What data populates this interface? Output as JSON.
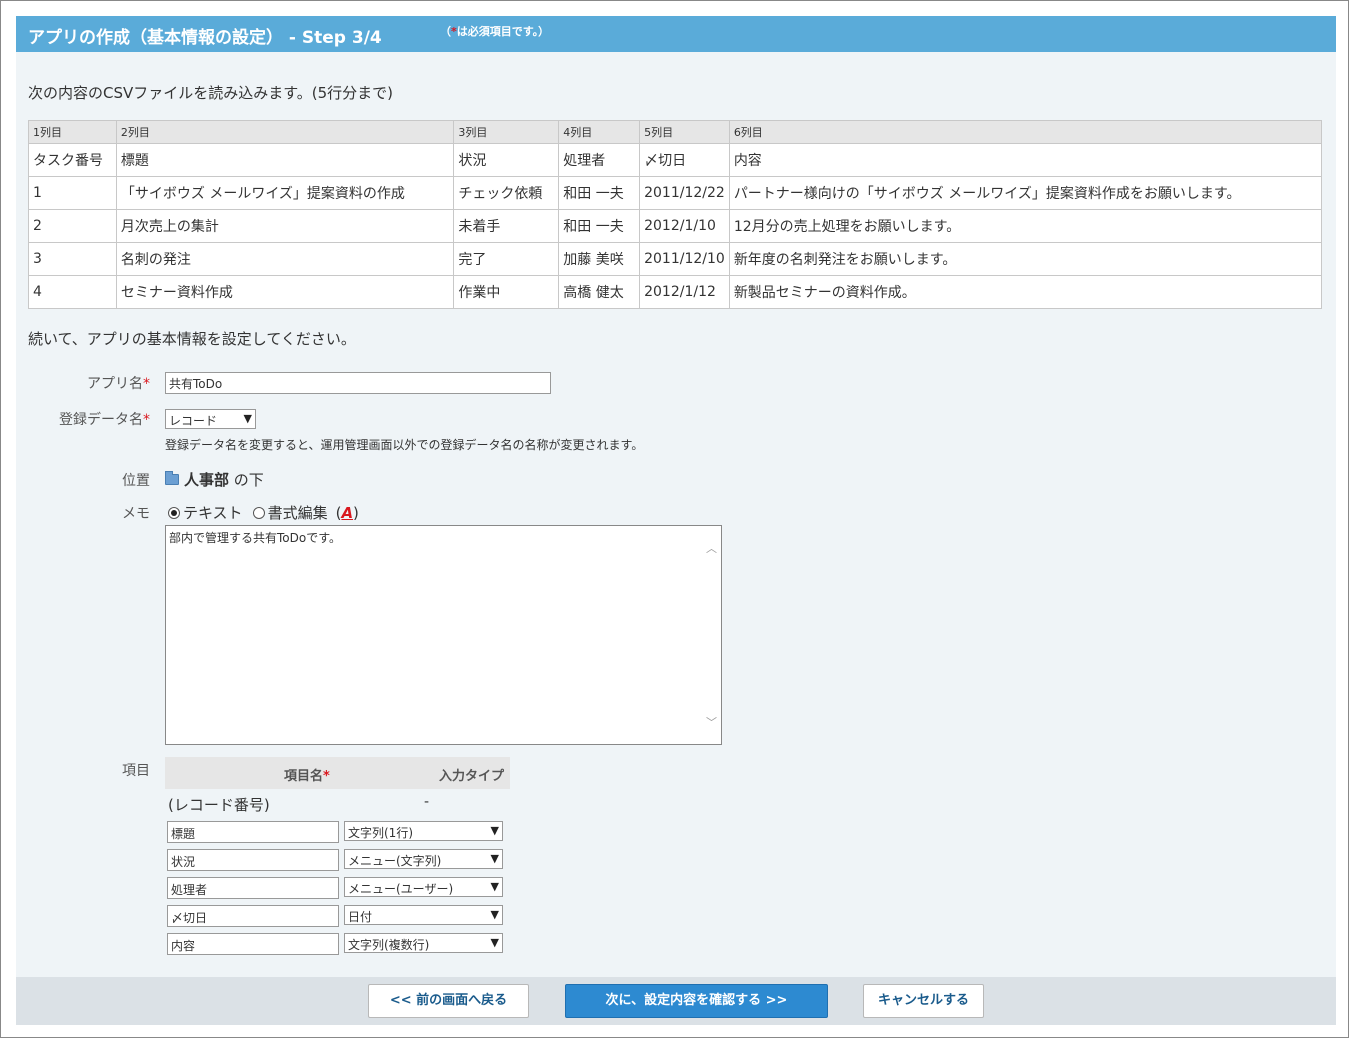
{
  "header": {
    "title": "アプリの作成（基本情報の設定） - Step 3/4",
    "note_open": "（",
    "note_req": "*",
    "note_text": "は必須項目です。）"
  },
  "intro": "次の内容のCSVファイルを読み込みます。(5行分まで)",
  "csv": {
    "columns": [
      "1列目",
      "2列目",
      "3列目",
      "4列目",
      "5列目",
      "6列目"
    ],
    "rows": [
      [
        "タスク番号",
        "標題",
        "状況",
        "処理者",
        "〆切日",
        "内容"
      ],
      [
        "1",
        "「サイボウズ メールワイズ」提案資料の作成",
        "チェック依頼",
        "和田 一夫",
        "2011/12/22",
        "パートナー様向けの「サイボウズ メールワイズ」提案資料作成をお願いします。"
      ],
      [
        "2",
        "月次売上の集計",
        "未着手",
        "和田 一夫",
        "2012/1/10",
        "12月分の売上処理をお願いします。"
      ],
      [
        "3",
        "名刺の発注",
        "完了",
        "加藤 美咲",
        "2011/12/10",
        "新年度の名刺発注をお願いします。"
      ],
      [
        "4",
        "セミナー資料作成",
        "作業中",
        "高橋 健太",
        "2012/1/12",
        "新製品セミナーの資料作成。"
      ]
    ]
  },
  "continue_text": "続いて、アプリの基本情報を設定してください。",
  "form": {
    "app_name_label": "アプリ名",
    "required_mark": "*",
    "app_name_value": "共有ToDo",
    "data_name_label": "登録データ名",
    "data_name_value": "レコード",
    "data_name_note": "登録データ名を変更すると、運用管理画面以外での登録データ名の名称が変更されます。",
    "location_label": "位置",
    "location_folder": "人事部",
    "location_suffix": "の下",
    "memo_label": "メモ",
    "memo_text_option": "テキスト",
    "memo_rich_option": "書式編集",
    "memo_paren_open": "(",
    "memo_format_icon": "A",
    "memo_paren_close": ")",
    "memo_value": "部内で管理する共有ToDoです。",
    "fields_label": "項目",
    "fields_name_header": "項目名",
    "fields_type_header": "入力タイプ",
    "record_number": "(レコード番号)",
    "record_number_type": "-",
    "fields": [
      {
        "name": "標題",
        "type": "文字列(1行)"
      },
      {
        "name": "状況",
        "type": "メニュー(文字列)"
      },
      {
        "name": "処理者",
        "type": "メニュー(ユーザー)"
      },
      {
        "name": "〆切日",
        "type": "日付"
      },
      {
        "name": "内容",
        "type": "文字列(複数行)"
      }
    ]
  },
  "buttons": {
    "back": "<< 前の画面へ戻る",
    "next": "次に、設定内容を確認する >>",
    "cancel": "キャンセルする"
  },
  "icons": {
    "select_arrow": "chevron-down-icon",
    "folder": "folder-icon",
    "format": "format-a-icon"
  },
  "colors": {
    "header_bg": "#5aabd9",
    "required": "#d9171e",
    "primary_button": "#2d8ad1"
  }
}
